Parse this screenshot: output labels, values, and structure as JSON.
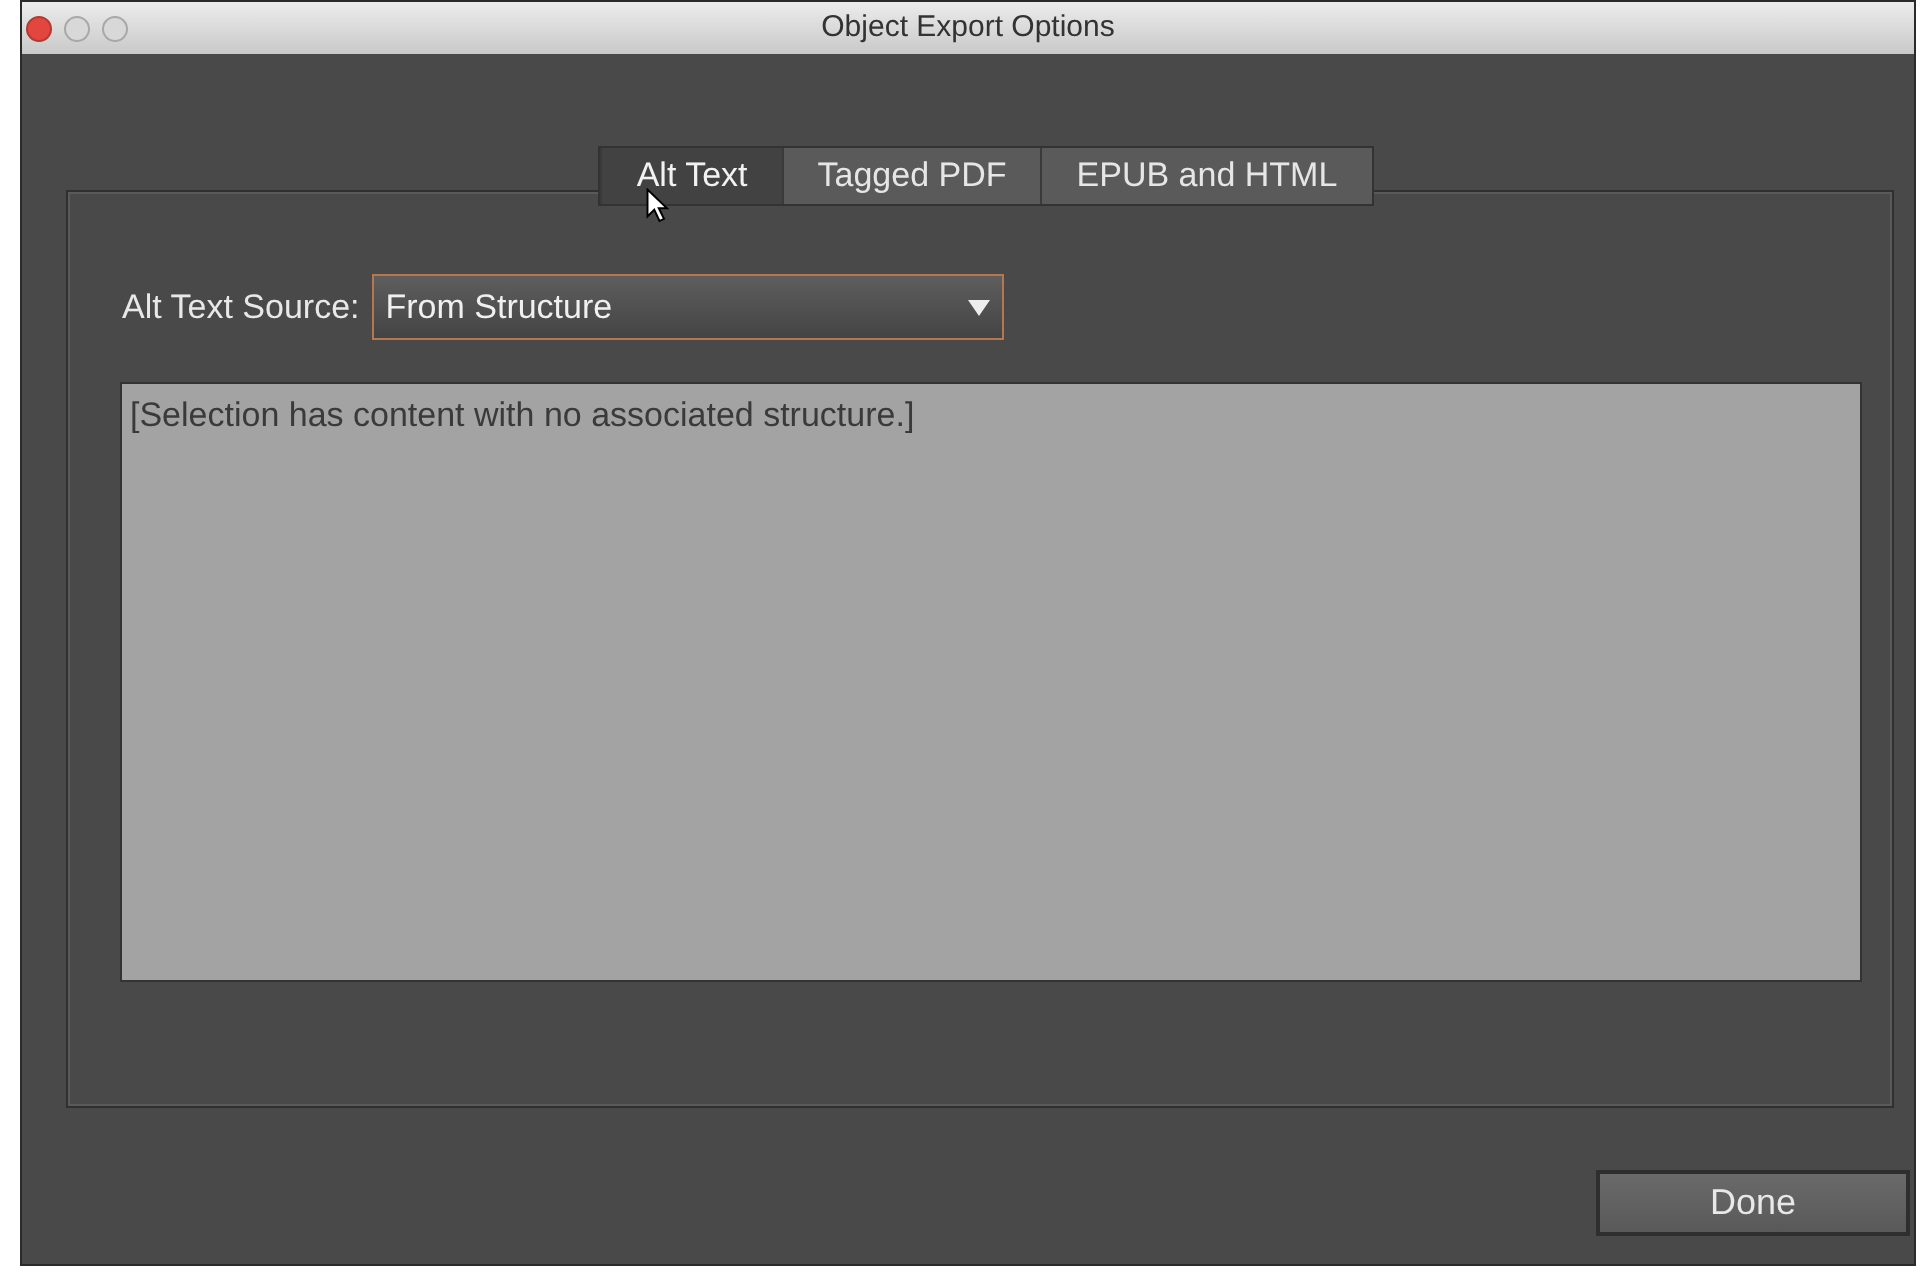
{
  "window": {
    "title": "Object Export Options"
  },
  "tabs": [
    {
      "label": "Alt Text",
      "selected": true
    },
    {
      "label": "Tagged PDF",
      "selected": false
    },
    {
      "label": "EPUB and HTML",
      "selected": false
    }
  ],
  "alt_text_source": {
    "label": "Alt Text Source:",
    "value": "From Structure"
  },
  "alt_text": {
    "value": "[Selection has content with no associated structure.]",
    "disabled": true
  },
  "buttons": [
    "Done"
  ]
}
